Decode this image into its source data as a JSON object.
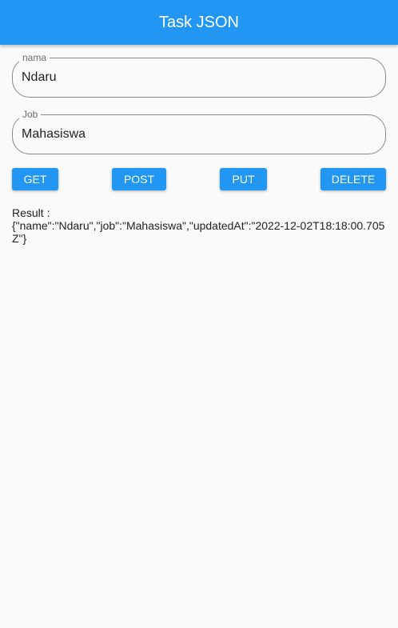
{
  "appbar": {
    "title": "Task JSON"
  },
  "form": {
    "nama": {
      "label": "nama",
      "value": "Ndaru"
    },
    "job": {
      "label": "Job",
      "value": "Mahasiswa"
    }
  },
  "buttons": {
    "get": "GET",
    "post": "POST",
    "put": "PUT",
    "delete": "DELETE"
  },
  "result": {
    "label": "Result :",
    "json": "{\"name\":\"Ndaru\",\"job\":\"Mahasiswa\",\"updatedAt\":\"2022-12-02T18:18:00.705Z\"}"
  },
  "colors": {
    "primary": "#2196f3",
    "background": "#fafafa",
    "outline": "#8a8a8a"
  }
}
